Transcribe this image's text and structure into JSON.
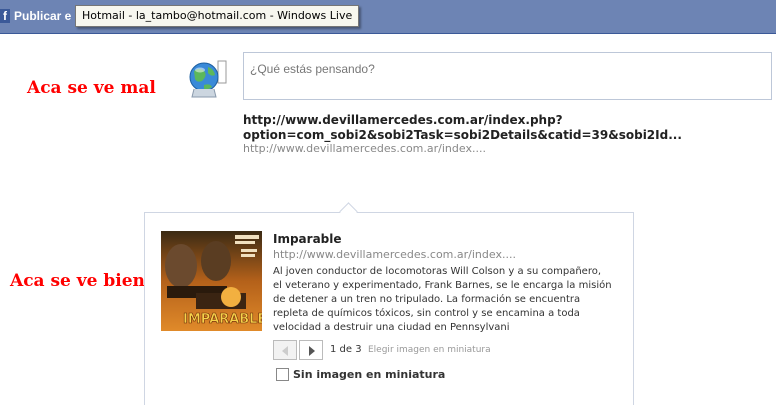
{
  "topbar": {
    "icon": "f",
    "title": "Publicar e",
    "tooltip": "Hotmail - la_tambo@hotmail.com - Windows Live"
  },
  "labels": {
    "bad": "Aca se ve mal",
    "good": "Aca se ve bien"
  },
  "bad_section": {
    "status_placeholder": "¿Qué estás pensando?",
    "link_title": "http://www.devillamercedes.com.ar/index.php?option=com_sobi2&sobi2Task=sobi2Details&catid=39&sobi2Id...",
    "link_url": "http://www.devillamercedes.com.ar/index...."
  },
  "good_section": {
    "title": "Imparable",
    "url": "http://www.devillamercedes.com.ar/index....",
    "description": "Al joven conductor de locomotoras Will Colson y a su compañero, el veterano y experimentado, Frank Barnes, se le encarga la misión de detener a un tren no tripulado. La formación se encuentra repleta de químicos tóxicos, sin control y se encamina a toda velocidad a destruir una ciudad en Pennsylvani",
    "page_count": "1 de 3",
    "choose_thumbnail": "Elegir imagen en miniatura",
    "no_thumbnail": "Sin imagen en miniatura",
    "no_thumbnail_checked": false,
    "poster_text": "IMPARABLE"
  },
  "colors": {
    "topbar": "#6d84b4",
    "label_red": "#ff0000",
    "border": "#bdc7d8"
  }
}
